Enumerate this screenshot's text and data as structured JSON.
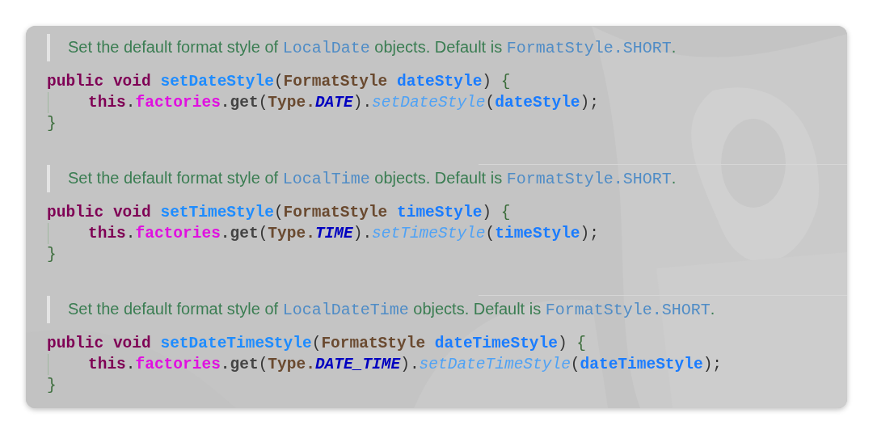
{
  "blocks": [
    {
      "description": [
        {
          "kind": "text",
          "text": "Set the default format style of "
        },
        {
          "kind": "code",
          "text": "LocalDate"
        },
        {
          "kind": "text",
          "text": " objects. Default is "
        },
        {
          "kind": "code",
          "text": "FormatStyle.SHORT"
        },
        {
          "kind": "text",
          "text": "."
        }
      ],
      "lines": [
        {
          "kind": "signature",
          "tokens": [
            {
              "kind": "keyword",
              "text": "public void "
            },
            {
              "kind": "method",
              "text": "setDateStyle"
            },
            {
              "kind": "punct",
              "text": "("
            },
            {
              "kind": "type",
              "text": "FormatStyle "
            },
            {
              "kind": "param",
              "text": "dateStyle"
            },
            {
              "kind": "punct",
              "text": ") "
            },
            {
              "kind": "brace",
              "text": "{"
            }
          ]
        },
        {
          "kind": "body",
          "tokens": [
            {
              "kind": "keyword",
              "text": "this"
            },
            {
              "kind": "punct",
              "text": "."
            },
            {
              "kind": "field",
              "text": "factories"
            },
            {
              "kind": "plain",
              "text": ".get"
            },
            {
              "kind": "punct",
              "text": "("
            },
            {
              "kind": "type",
              "text": "Type."
            },
            {
              "kind": "constant",
              "text": "DATE"
            },
            {
              "kind": "punct",
              "text": ")."
            },
            {
              "kind": "call",
              "text": "setDateStyle"
            },
            {
              "kind": "punct",
              "text": "("
            },
            {
              "kind": "param",
              "text": "dateStyle"
            },
            {
              "kind": "punct",
              "text": ");"
            }
          ]
        },
        {
          "kind": "close",
          "tokens": [
            {
              "kind": "brace",
              "text": "}"
            }
          ]
        }
      ]
    },
    {
      "description": [
        {
          "kind": "text",
          "text": "Set the default format style of "
        },
        {
          "kind": "code",
          "text": "LocalTime"
        },
        {
          "kind": "text",
          "text": " objects. Default is "
        },
        {
          "kind": "code",
          "text": "FormatStyle.SHORT"
        },
        {
          "kind": "text",
          "text": "."
        }
      ],
      "lines": [
        {
          "kind": "signature",
          "tokens": [
            {
              "kind": "keyword",
              "text": "public void "
            },
            {
              "kind": "method",
              "text": "setTimeStyle"
            },
            {
              "kind": "punct",
              "text": "("
            },
            {
              "kind": "type",
              "text": "FormatStyle "
            },
            {
              "kind": "param",
              "text": "timeStyle"
            },
            {
              "kind": "punct",
              "text": ") "
            },
            {
              "kind": "brace",
              "text": "{"
            }
          ]
        },
        {
          "kind": "body",
          "tokens": [
            {
              "kind": "keyword",
              "text": "this"
            },
            {
              "kind": "punct",
              "text": "."
            },
            {
              "kind": "field",
              "text": "factories"
            },
            {
              "kind": "plain",
              "text": ".get"
            },
            {
              "kind": "punct",
              "text": "("
            },
            {
              "kind": "type",
              "text": "Type."
            },
            {
              "kind": "constant",
              "text": "TIME"
            },
            {
              "kind": "punct",
              "text": ")."
            },
            {
              "kind": "call",
              "text": "setTimeStyle"
            },
            {
              "kind": "punct",
              "text": "("
            },
            {
              "kind": "param",
              "text": "timeStyle"
            },
            {
              "kind": "punct",
              "text": ");"
            }
          ]
        },
        {
          "kind": "close",
          "tokens": [
            {
              "kind": "brace",
              "text": "}"
            }
          ]
        }
      ]
    },
    {
      "description": [
        {
          "kind": "text",
          "text": "Set the default format style of "
        },
        {
          "kind": "code",
          "text": "LocalDateTime"
        },
        {
          "kind": "text",
          "text": " objects. Default is "
        },
        {
          "kind": "code",
          "text": "FormatStyle.SHORT"
        },
        {
          "kind": "text",
          "text": "."
        }
      ],
      "lines": [
        {
          "kind": "signature",
          "tokens": [
            {
              "kind": "keyword",
              "text": "public void "
            },
            {
              "kind": "method",
              "text": "setDateTimeStyle"
            },
            {
              "kind": "punct",
              "text": "("
            },
            {
              "kind": "type",
              "text": "FormatStyle "
            },
            {
              "kind": "param",
              "text": "dateTimeStyle"
            },
            {
              "kind": "punct",
              "text": ") "
            },
            {
              "kind": "brace",
              "text": "{"
            }
          ]
        },
        {
          "kind": "body",
          "tokens": [
            {
              "kind": "keyword",
              "text": "this"
            },
            {
              "kind": "punct",
              "text": "."
            },
            {
              "kind": "field",
              "text": "factories"
            },
            {
              "kind": "plain",
              "text": ".get"
            },
            {
              "kind": "punct",
              "text": "("
            },
            {
              "kind": "type",
              "text": "Type."
            },
            {
              "kind": "constant",
              "text": "DATE_TIME"
            },
            {
              "kind": "punct",
              "text": ")."
            },
            {
              "kind": "call",
              "text": "setDateTimeStyle"
            },
            {
              "kind": "punct",
              "text": "("
            },
            {
              "kind": "param",
              "text": "dateTimeStyle"
            },
            {
              "kind": "punct",
              "text": ");"
            }
          ]
        },
        {
          "kind": "close",
          "tokens": [
            {
              "kind": "brace",
              "text": "}"
            }
          ]
        }
      ]
    }
  ]
}
